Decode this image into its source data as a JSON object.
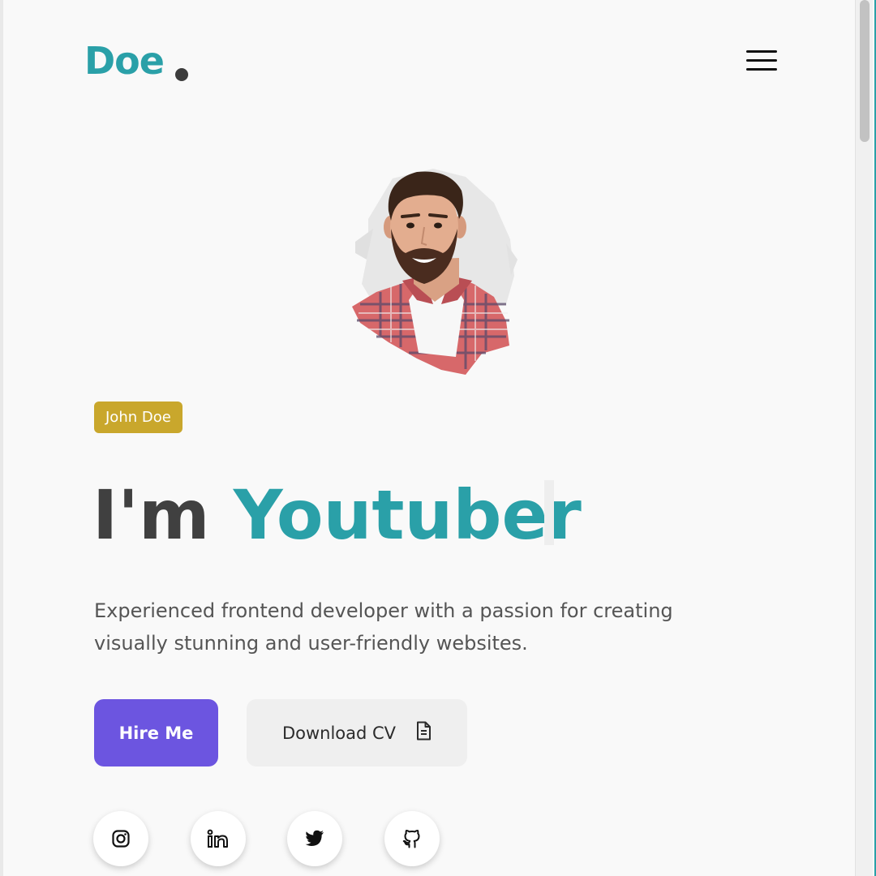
{
  "brand": {
    "name": "Doe",
    "accent_color": "#2aa0a8",
    "dot_color": "#3c3c3c"
  },
  "nav": {
    "menu_icon": "hamburger-menu-icon"
  },
  "hero": {
    "avatar_alt": "portrait-photo",
    "badge": "John Doe",
    "badge_color": "#c9a72c",
    "headline_prefix": "I'm",
    "headline_role": "Youtuber",
    "description": "Experienced frontend developer with a passion for creating visually stunning and user-friendly websites."
  },
  "actions": {
    "hire_label": "Hire Me",
    "hire_color": "#6c55e0",
    "download_label": "Download CV",
    "download_icon": "file-document-icon"
  },
  "social": [
    {
      "name": "instagram",
      "icon": "instagram-icon"
    },
    {
      "name": "linkedin",
      "icon": "linkedin-icon"
    },
    {
      "name": "twitter",
      "icon": "twitter-icon"
    },
    {
      "name": "github",
      "icon": "github-icon"
    }
  ]
}
